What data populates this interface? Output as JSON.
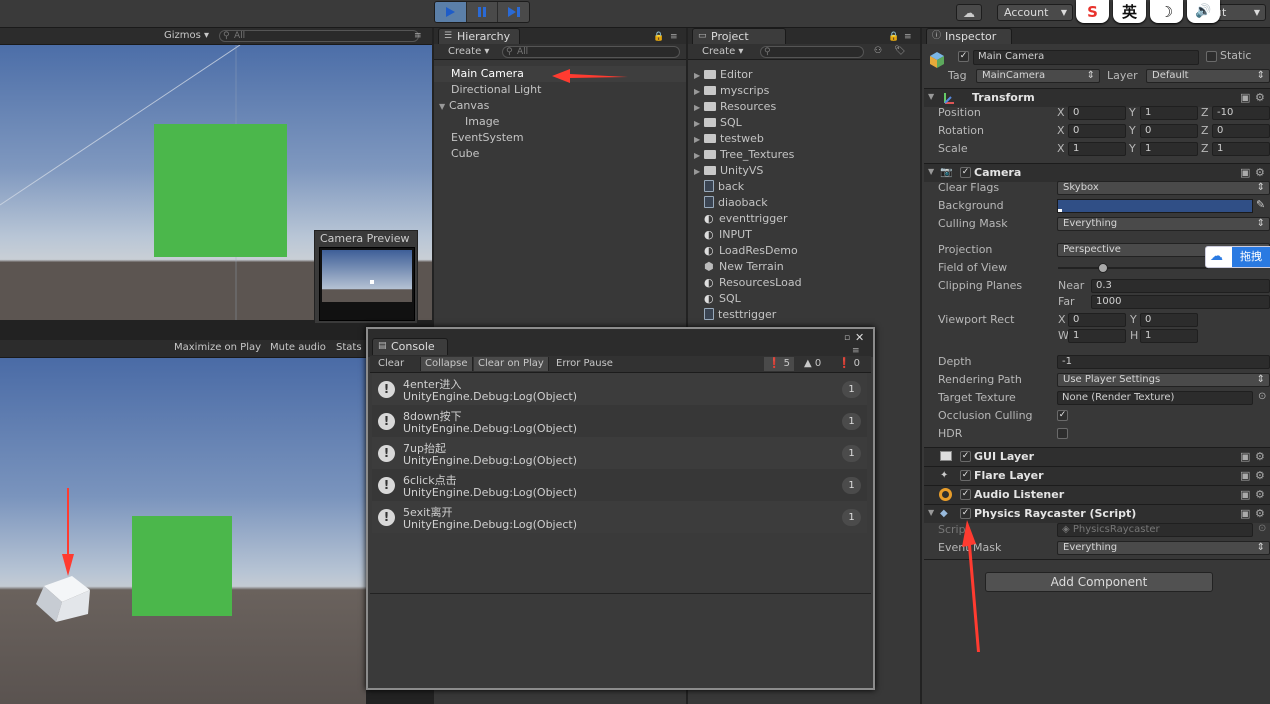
{
  "toolbar": {
    "account_label": "Account",
    "layers_label": "ut",
    "ime_buttons": [
      "S",
      "英",
      "☽",
      "🔊"
    ]
  },
  "scene": {
    "gizmos_label": "Gizmos",
    "search_placeholder": "All",
    "camera_preview_title": "Camera Preview",
    "ground_color": "#5c5551",
    "sky_top_color": "#4c6ea8",
    "sky_bottom_color": "#b9c6d6",
    "plane_color": "#4bb74b"
  },
  "game": {
    "maximize_label": "Maximize on Play",
    "mute_label": "Mute audio",
    "stats_label": "Stats"
  },
  "hierarchy": {
    "tab_label": "Hierarchy",
    "create_label": "Create",
    "search_placeholder": "All",
    "items": [
      {
        "label": "Main Camera",
        "selected": true
      },
      {
        "label": "Directional Light"
      },
      {
        "label": "Canvas",
        "expanded": true
      },
      {
        "label": "Image",
        "child": true
      },
      {
        "label": "EventSystem"
      },
      {
        "label": "Cube"
      }
    ]
  },
  "project": {
    "tab_label": "Project",
    "create_label": "Create",
    "items": [
      {
        "label": "Editor",
        "type": "folder"
      },
      {
        "label": "myscrips",
        "type": "folder"
      },
      {
        "label": "Resources",
        "type": "folder"
      },
      {
        "label": "SQL",
        "type": "folder"
      },
      {
        "label": "testweb",
        "type": "folder"
      },
      {
        "label": "Tree_Textures",
        "type": "folder"
      },
      {
        "label": "UnityVS",
        "type": "folder"
      },
      {
        "label": "back",
        "type": "script"
      },
      {
        "label": "diaoback",
        "type": "script"
      },
      {
        "label": "eventtrigger",
        "type": "unity"
      },
      {
        "label": "INPUT",
        "type": "unity"
      },
      {
        "label": "LoadResDemo",
        "type": "unity"
      },
      {
        "label": "New Terrain",
        "type": "terrain"
      },
      {
        "label": "ResourcesLoad",
        "type": "unity"
      },
      {
        "label": "SQL",
        "type": "unity"
      },
      {
        "label": "testtrigger",
        "type": "script"
      }
    ]
  },
  "console": {
    "title": "Console",
    "buttons": [
      "Clear",
      "Collapse",
      "Clear on Play",
      "Error Pause"
    ],
    "log_count": "5",
    "warn_count": "0",
    "error_count": "0",
    "entries": [
      {
        "line1": "4enter进入",
        "line2": "UnityEngine.Debug:Log(Object)",
        "count": "1"
      },
      {
        "line1": "8down按下",
        "line2": "UnityEngine.Debug:Log(Object)",
        "count": "1"
      },
      {
        "line1": "7up抬起",
        "line2": "UnityEngine.Debug:Log(Object)",
        "count": "1"
      },
      {
        "line1": "6click点击",
        "line2": "UnityEngine.Debug:Log(Object)",
        "count": "1"
      },
      {
        "line1": "5exit离开",
        "line2": "UnityEngine.Debug:Log(Object)",
        "count": "1"
      }
    ]
  },
  "inspector": {
    "tab_label": "Inspector",
    "object_name": "Main Camera",
    "static_label": "Static",
    "tag_label": "Tag",
    "tag_value": "MainCamera",
    "layer_label": "Layer",
    "layer_value": "Default",
    "transform": {
      "title": "Transform",
      "position_label": "Position",
      "rotation_label": "Rotation",
      "scale_label": "Scale",
      "axes": [
        "X",
        "Y",
        "Z"
      ],
      "position": [
        "0",
        "1",
        "-10"
      ],
      "rotation": [
        "0",
        "0",
        "0"
      ],
      "scale": [
        "1",
        "1",
        "1"
      ]
    },
    "camera": {
      "title": "Camera",
      "clear_flags_label": "Clear Flags",
      "clear_flags_value": "Skybox",
      "background_label": "Background",
      "background_color": "#304f86",
      "culling_mask_label": "Culling Mask",
      "culling_mask_value": "Everything",
      "projection_label": "Projection",
      "projection_value": "Perspective",
      "fov_label": "Field of View",
      "fov_value": 0.3,
      "clipping_label": "Clipping Planes",
      "near_label": "Near",
      "near_value": "0.3",
      "far_label": "Far",
      "far_value": "1000",
      "viewport_label": "Viewport Rect",
      "vx_label": "X",
      "vx_value": "0",
      "vy_label": "Y",
      "vy_value": "0",
      "vw_label": "W",
      "vw_value": "1",
      "vh_label": "H",
      "vh_value": "1",
      "depth_label": "Depth",
      "depth_value": "-1",
      "rendering_path_label": "Rendering Path",
      "rendering_path_value": "Use Player Settings",
      "target_texture_label": "Target Texture",
      "target_texture_value": "None (Render Texture)",
      "occlusion_label": "Occlusion Culling",
      "hdr_label": "HDR"
    },
    "gui_layer_title": "GUI Layer",
    "flare_layer_title": "Flare Layer",
    "audio_listener_title": "Audio Listener",
    "raycaster": {
      "title": "Physics Raycaster (Script)",
      "script_label": "Script",
      "script_value": "PhysicsRaycaster",
      "event_mask_label": "Event Mask",
      "event_mask_value": "Everything"
    },
    "add_component_label": "Add Component"
  },
  "overlay": {
    "baidu_label": "拖拽"
  },
  "colors": {
    "arrow": "#ff3b30",
    "play_active": "#5b7fa8"
  }
}
